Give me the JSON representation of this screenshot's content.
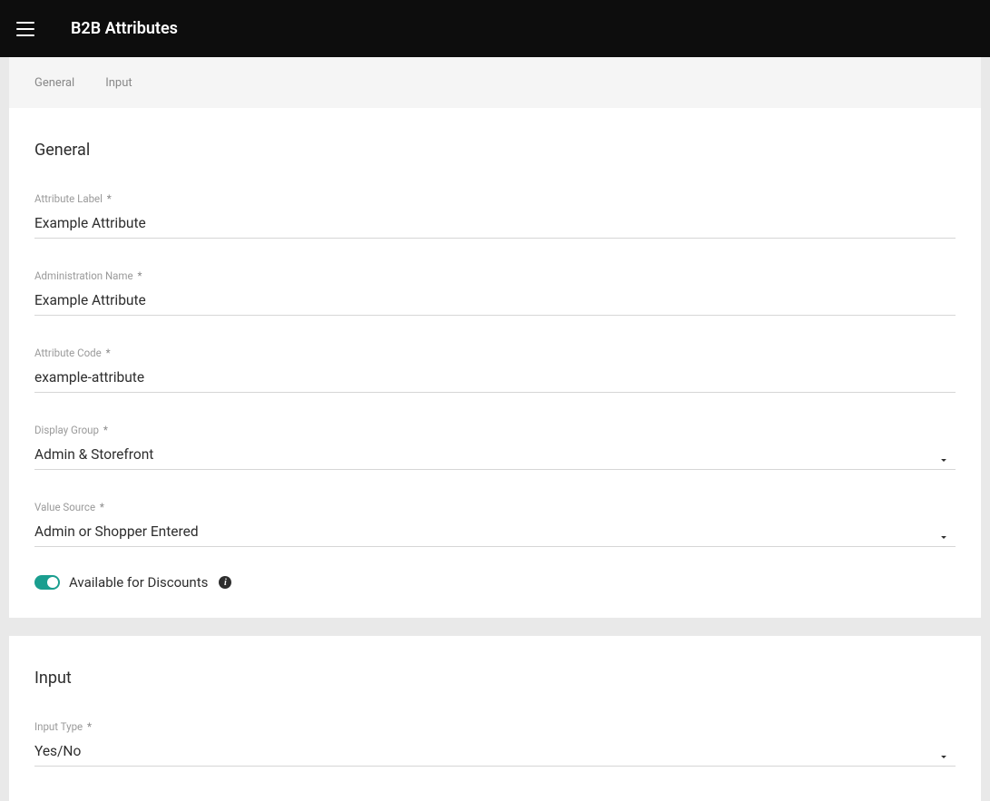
{
  "header": {
    "title": "B2B Attributes"
  },
  "tabs": {
    "general": "General",
    "input": "Input"
  },
  "sections": {
    "general": {
      "title": "General",
      "fields": {
        "attribute_label": {
          "label": "Attribute Label",
          "value": "Example Attribute"
        },
        "administration_name": {
          "label": "Administration Name",
          "value": "Example Attribute"
        },
        "attribute_code": {
          "label": "Attribute Code",
          "value": "example-attribute"
        },
        "display_group": {
          "label": "Display Group",
          "value": "Admin & Storefront"
        },
        "value_source": {
          "label": "Value Source",
          "value": "Admin or Shopper Entered"
        }
      },
      "toggle": {
        "label": "Available for Discounts",
        "on": true
      }
    },
    "input": {
      "title": "Input",
      "fields": {
        "input_type": {
          "label": "Input Type",
          "value": "Yes/No"
        }
      }
    }
  },
  "required_mark": "*"
}
